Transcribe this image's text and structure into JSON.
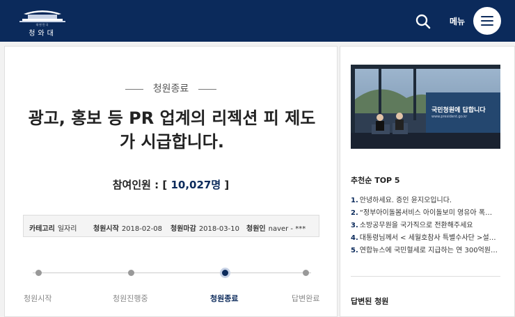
{
  "header": {
    "logo_sub": "대한민국",
    "logo_name": "청와대",
    "menu_label": "메뉴"
  },
  "petition": {
    "status": "청원종료",
    "title": "광고, 홍보 등 PR 업계의 리젝션 피 제도가 시급합니다.",
    "count_label": "참여인원 : [ ",
    "count_value": "10,027명",
    "count_close": " ]",
    "info": {
      "category_label": "카테고리",
      "category_value": "일자리",
      "start_label": "청원시작",
      "start_value": "2018-02-08",
      "end_label": "청원마감",
      "end_value": "2018-03-10",
      "author_label": "청원인",
      "author_value": "naver - ***"
    },
    "timeline": [
      "청원시작",
      "청원진행중",
      "청원종료",
      "답변완료"
    ],
    "timeline_active": 2
  },
  "sidebar": {
    "video_caption": "국민청원에 답합니다",
    "video_url": "www.president.go.kr",
    "top5_title": "추천순 TOP 5",
    "top5": [
      {
        "n": "1.",
        "text": "안녕하세요. 증인 윤지오입니다."
      },
      {
        "n": "2.",
        "text": "“정부아이돌봄서비스 아이돌보미 영유아 폭…"
      },
      {
        "n": "3.",
        "text": "소방공무원을 국가직으로 전환해주세요"
      },
      {
        "n": "4.",
        "text": "대통령님께서 < 세월호참사 특별수사단 >설…"
      },
      {
        "n": "5.",
        "text": "연합뉴스에 국민혈세로 지급하는 연 300억원…"
      }
    ],
    "answered_title": "답변된 청원"
  },
  "colors": {
    "brand_navy": "#0b2a5b"
  }
}
